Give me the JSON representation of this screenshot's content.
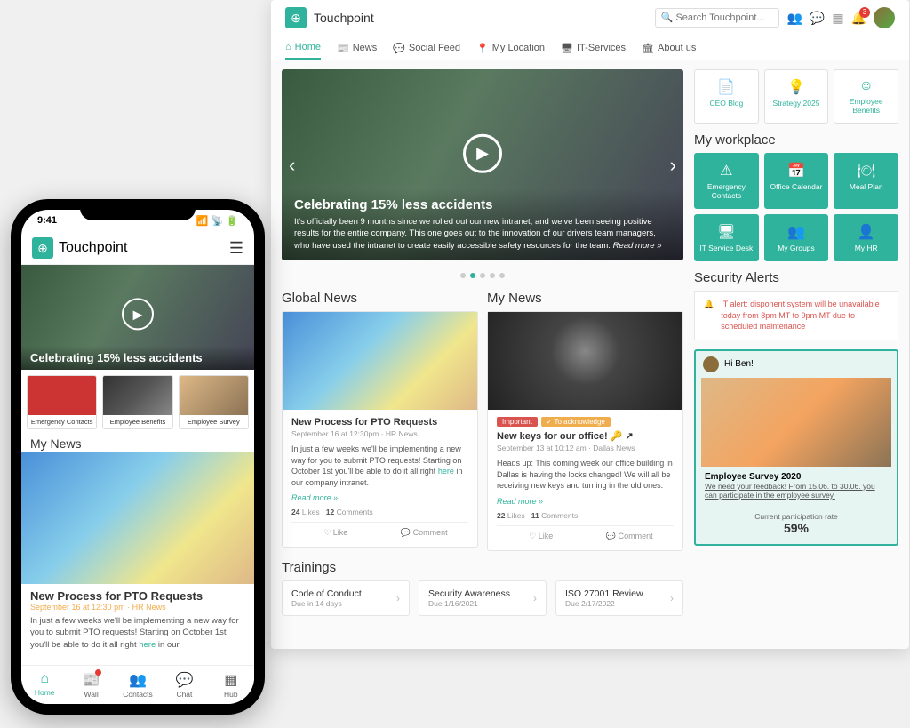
{
  "app": {
    "name": "Touchpoint"
  },
  "header": {
    "search_placeholder": "Search Touchpoint...",
    "notif_count": "3"
  },
  "nav": {
    "items": [
      {
        "label": "Home",
        "icon": "⌂"
      },
      {
        "label": "News",
        "icon": "📰"
      },
      {
        "label": "Social Feed",
        "icon": "💬"
      },
      {
        "label": "My Location",
        "icon": "📍"
      },
      {
        "label": "IT-Services",
        "icon": "🖥"
      },
      {
        "label": "About us",
        "icon": "🏛"
      }
    ]
  },
  "hero": {
    "title": "Celebrating 15% less accidents",
    "body": "It's officially been 9 months since we rolled out our new intranet, and we've been seeing positive results for the entire company. This one goes out to the innovation of our drivers team managers, who have used the intranet to create easily accessible safety resources for the team.",
    "read_more": "Read more »"
  },
  "global_news": {
    "title": "Global News",
    "card": {
      "title": "New Process for PTO Requests",
      "meta": "September 16 at 12:30pm · HR News",
      "text": "In just a few weeks we'll be implementing a new way for you to submit PTO requests! Starting on October 1st you'll be able to do it all right ",
      "link": "here",
      "text2": " in our company intranet.",
      "more": "Read more »",
      "likes": "24",
      "likes_label": "Likes",
      "comments": "12",
      "comments_label": "Comments",
      "like_btn": "Like",
      "comment_btn": "Comment"
    }
  },
  "my_news": {
    "title": "My News",
    "card": {
      "badge_important": "Important",
      "badge_ack": "To acknowledge",
      "title": "New keys for our office! 🔑",
      "meta": "September 13 at 10:12 am · Dallas News",
      "text": "Heads up: This coming week our office building in Dallas is having the locks changed! We will all be receiving new keys and turning in the old ones.",
      "more": "Read more »",
      "likes": "22",
      "likes_label": "Likes",
      "comments": "11",
      "comments_label": "Comments",
      "like_btn": "Like",
      "comment_btn": "Comment"
    }
  },
  "trainings": {
    "title": "Trainings",
    "items": [
      {
        "title": "Code of Conduct",
        "due": "Due in 14 days"
      },
      {
        "title": "Security Awareness",
        "due": "Due 1/16/2021"
      },
      {
        "title": "ISO 27001 Review",
        "due": "Due 2/17/2022"
      }
    ]
  },
  "quick_tiles": [
    {
      "label": "CEO Blog",
      "icon": "📄"
    },
    {
      "label": "Strategy 2025",
      "icon": "💡"
    },
    {
      "label": "Employee Benefits",
      "icon": "☺"
    }
  ],
  "workplace": {
    "title": "My workplace",
    "tiles": [
      {
        "label": "Emergency Contacts",
        "icon": "⚠"
      },
      {
        "label": "Office Calendar",
        "icon": "📅"
      },
      {
        "label": "Meal Plan",
        "icon": "🍽"
      },
      {
        "label": "IT Service Desk",
        "icon": "🖥"
      },
      {
        "label": "My Groups",
        "icon": "👥"
      },
      {
        "label": "My HR",
        "icon": "👤"
      }
    ]
  },
  "security": {
    "title": "Security Alerts",
    "alert": "IT alert: disponent system will be unavailable today from 8pm MT to 9pm MT due to scheduled maintenance"
  },
  "survey": {
    "greeting": "Hi Ben!",
    "title": "Employee Survey 2020",
    "text": "We need your feedback! From 15.06. to 30.06. you can participate in the employee survey.",
    "rate_label": "Current participation rate",
    "rate_value": "59%"
  },
  "phone": {
    "time": "9:41",
    "hero_title": "Celebrating 15% less accidents",
    "tiles": [
      {
        "label": "Emergency Contacts"
      },
      {
        "label": "Employee Benefits"
      },
      {
        "label": "Employee Survey"
      }
    ],
    "my_news_title": "My News",
    "news": {
      "title": "New Process for PTO Requests",
      "meta": "September 16 at 12:30 pm · HR News",
      "text": "In just a few weeks we'll be implementing a new way for you to submit PTO requests! Starting on October 1st you'll be able to do it all right ",
      "link": "here",
      "text2": " in our"
    },
    "tabs": [
      {
        "label": "Home",
        "icon": "⌂"
      },
      {
        "label": "Wall",
        "icon": "📰"
      },
      {
        "label": "Contacts",
        "icon": "👥"
      },
      {
        "label": "Chat",
        "icon": "💬"
      },
      {
        "label": "Hub",
        "icon": "▦"
      }
    ]
  }
}
